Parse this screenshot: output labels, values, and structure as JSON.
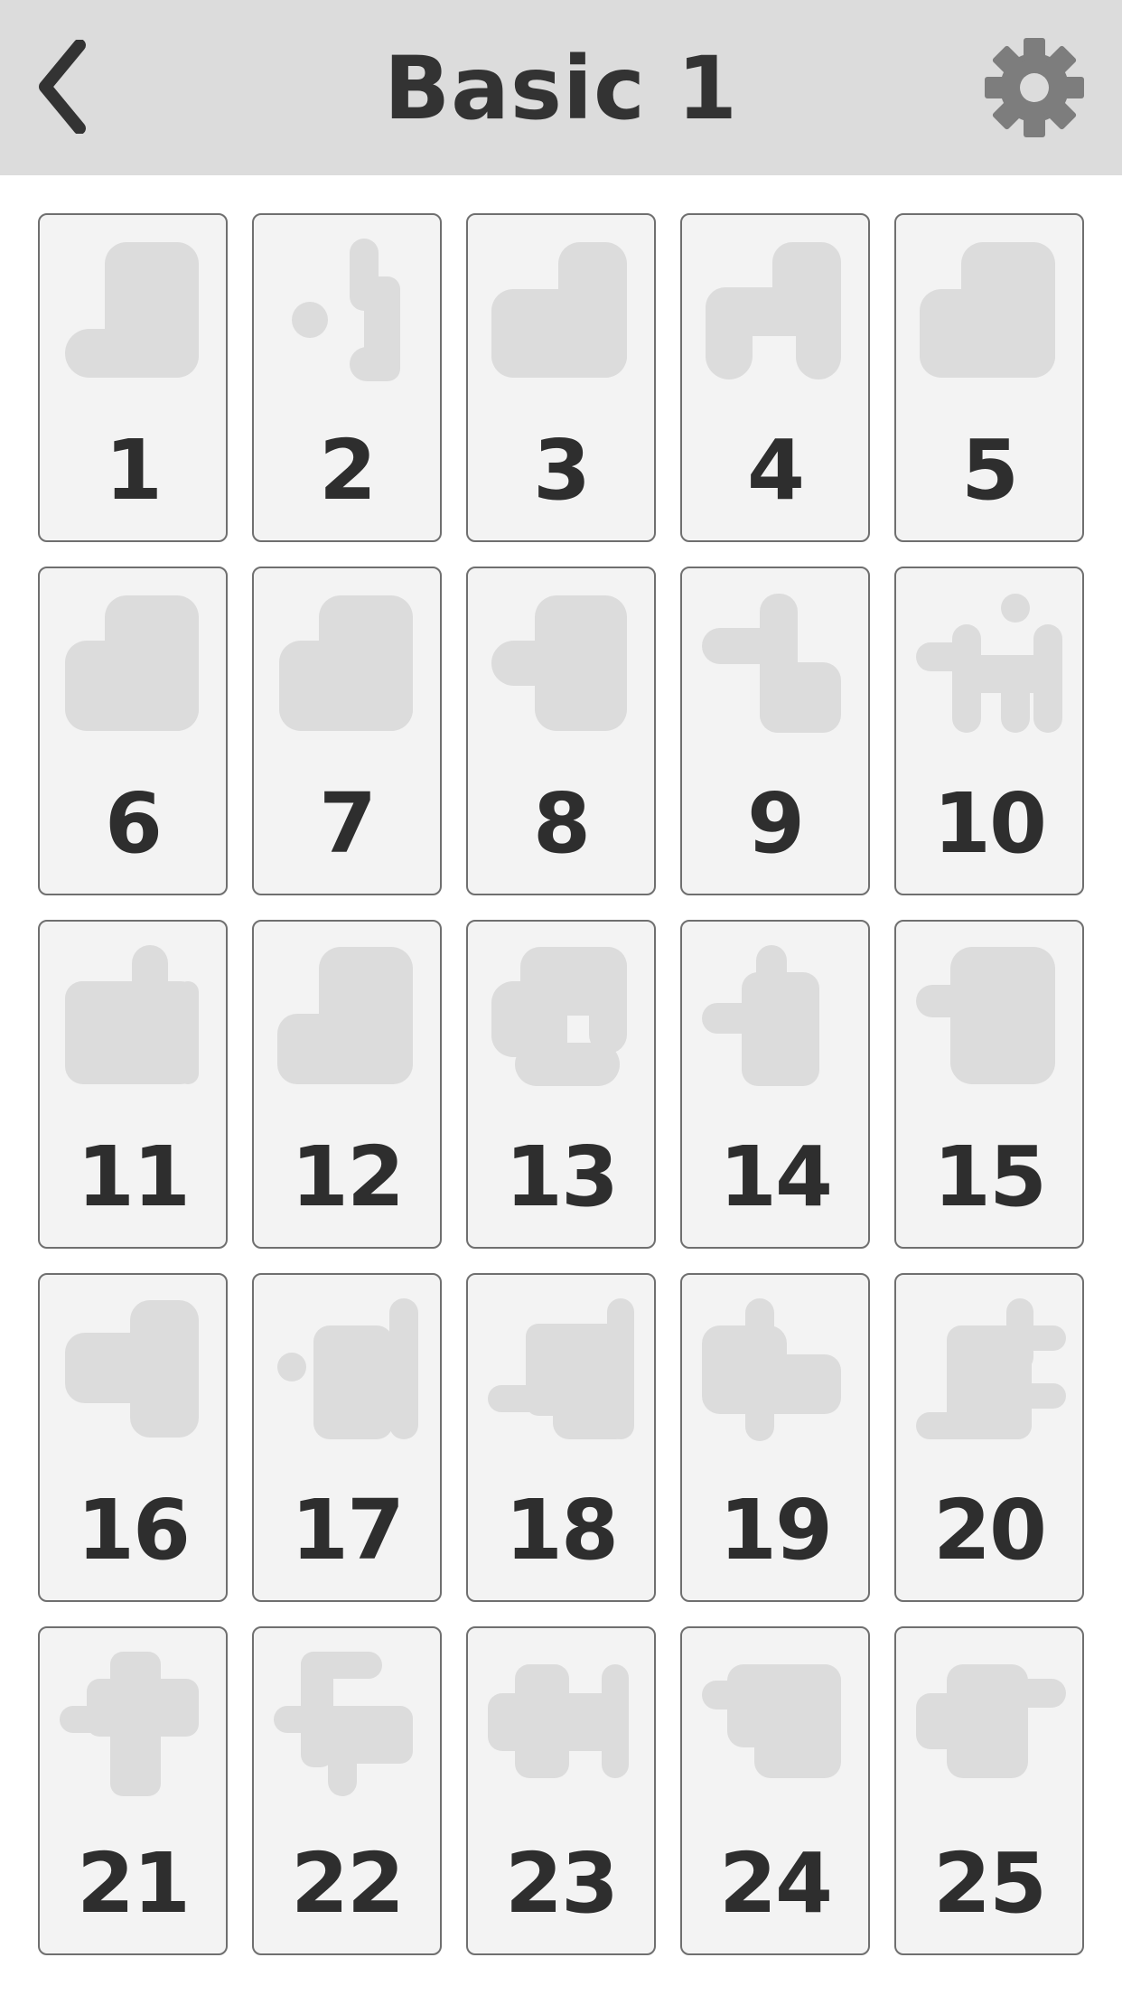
{
  "header": {
    "title": "Basic 1",
    "back_icon": "chevron-left-icon",
    "settings_icon": "gear-icon",
    "background": "#dcdcdc"
  },
  "colors": {
    "card_bg": "#f3f3f3",
    "card_border": "#6f6f6f",
    "piece_fill": "#dcdcdc",
    "number_text": "#2e2e2e"
  },
  "levels": [
    {
      "label": "1"
    },
    {
      "label": "2"
    },
    {
      "label": "3"
    },
    {
      "label": "4"
    },
    {
      "label": "5"
    },
    {
      "label": "6"
    },
    {
      "label": "7"
    },
    {
      "label": "8"
    },
    {
      "label": "9"
    },
    {
      "label": "10"
    },
    {
      "label": "11"
    },
    {
      "label": "12"
    },
    {
      "label": "13"
    },
    {
      "label": "14"
    },
    {
      "label": "15"
    },
    {
      "label": "16"
    },
    {
      "label": "17"
    },
    {
      "label": "18"
    },
    {
      "label": "19"
    },
    {
      "label": "20"
    },
    {
      "label": "21"
    },
    {
      "label": "22"
    },
    {
      "label": "23"
    },
    {
      "label": "24"
    },
    {
      "label": "25"
    }
  ]
}
